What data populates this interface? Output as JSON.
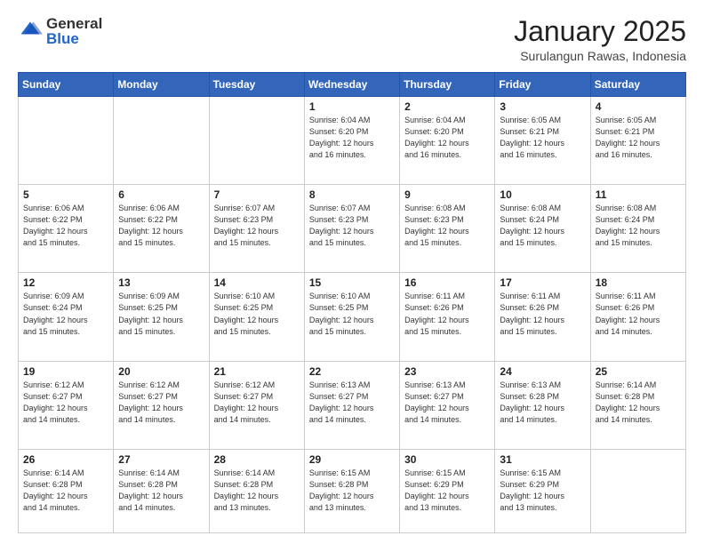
{
  "logo": {
    "general": "General",
    "blue": "Blue"
  },
  "header": {
    "month": "January 2025",
    "location": "Surulangun Rawas, Indonesia"
  },
  "days_of_week": [
    "Sunday",
    "Monday",
    "Tuesday",
    "Wednesday",
    "Thursday",
    "Friday",
    "Saturday"
  ],
  "weeks": [
    [
      {
        "day": "",
        "info": ""
      },
      {
        "day": "",
        "info": ""
      },
      {
        "day": "",
        "info": ""
      },
      {
        "day": "1",
        "info": "Sunrise: 6:04 AM\nSunset: 6:20 PM\nDaylight: 12 hours\nand 16 minutes."
      },
      {
        "day": "2",
        "info": "Sunrise: 6:04 AM\nSunset: 6:20 PM\nDaylight: 12 hours\nand 16 minutes."
      },
      {
        "day": "3",
        "info": "Sunrise: 6:05 AM\nSunset: 6:21 PM\nDaylight: 12 hours\nand 16 minutes."
      },
      {
        "day": "4",
        "info": "Sunrise: 6:05 AM\nSunset: 6:21 PM\nDaylight: 12 hours\nand 16 minutes."
      }
    ],
    [
      {
        "day": "5",
        "info": "Sunrise: 6:06 AM\nSunset: 6:22 PM\nDaylight: 12 hours\nand 15 minutes."
      },
      {
        "day": "6",
        "info": "Sunrise: 6:06 AM\nSunset: 6:22 PM\nDaylight: 12 hours\nand 15 minutes."
      },
      {
        "day": "7",
        "info": "Sunrise: 6:07 AM\nSunset: 6:23 PM\nDaylight: 12 hours\nand 15 minutes."
      },
      {
        "day": "8",
        "info": "Sunrise: 6:07 AM\nSunset: 6:23 PM\nDaylight: 12 hours\nand 15 minutes."
      },
      {
        "day": "9",
        "info": "Sunrise: 6:08 AM\nSunset: 6:23 PM\nDaylight: 12 hours\nand 15 minutes."
      },
      {
        "day": "10",
        "info": "Sunrise: 6:08 AM\nSunset: 6:24 PM\nDaylight: 12 hours\nand 15 minutes."
      },
      {
        "day": "11",
        "info": "Sunrise: 6:08 AM\nSunset: 6:24 PM\nDaylight: 12 hours\nand 15 minutes."
      }
    ],
    [
      {
        "day": "12",
        "info": "Sunrise: 6:09 AM\nSunset: 6:24 PM\nDaylight: 12 hours\nand 15 minutes."
      },
      {
        "day": "13",
        "info": "Sunrise: 6:09 AM\nSunset: 6:25 PM\nDaylight: 12 hours\nand 15 minutes."
      },
      {
        "day": "14",
        "info": "Sunrise: 6:10 AM\nSunset: 6:25 PM\nDaylight: 12 hours\nand 15 minutes."
      },
      {
        "day": "15",
        "info": "Sunrise: 6:10 AM\nSunset: 6:25 PM\nDaylight: 12 hours\nand 15 minutes."
      },
      {
        "day": "16",
        "info": "Sunrise: 6:11 AM\nSunset: 6:26 PM\nDaylight: 12 hours\nand 15 minutes."
      },
      {
        "day": "17",
        "info": "Sunrise: 6:11 AM\nSunset: 6:26 PM\nDaylight: 12 hours\nand 15 minutes."
      },
      {
        "day": "18",
        "info": "Sunrise: 6:11 AM\nSunset: 6:26 PM\nDaylight: 12 hours\nand 14 minutes."
      }
    ],
    [
      {
        "day": "19",
        "info": "Sunrise: 6:12 AM\nSunset: 6:27 PM\nDaylight: 12 hours\nand 14 minutes."
      },
      {
        "day": "20",
        "info": "Sunrise: 6:12 AM\nSunset: 6:27 PM\nDaylight: 12 hours\nand 14 minutes."
      },
      {
        "day": "21",
        "info": "Sunrise: 6:12 AM\nSunset: 6:27 PM\nDaylight: 12 hours\nand 14 minutes."
      },
      {
        "day": "22",
        "info": "Sunrise: 6:13 AM\nSunset: 6:27 PM\nDaylight: 12 hours\nand 14 minutes."
      },
      {
        "day": "23",
        "info": "Sunrise: 6:13 AM\nSunset: 6:27 PM\nDaylight: 12 hours\nand 14 minutes."
      },
      {
        "day": "24",
        "info": "Sunrise: 6:13 AM\nSunset: 6:28 PM\nDaylight: 12 hours\nand 14 minutes."
      },
      {
        "day": "25",
        "info": "Sunrise: 6:14 AM\nSunset: 6:28 PM\nDaylight: 12 hours\nand 14 minutes."
      }
    ],
    [
      {
        "day": "26",
        "info": "Sunrise: 6:14 AM\nSunset: 6:28 PM\nDaylight: 12 hours\nand 14 minutes."
      },
      {
        "day": "27",
        "info": "Sunrise: 6:14 AM\nSunset: 6:28 PM\nDaylight: 12 hours\nand 14 minutes."
      },
      {
        "day": "28",
        "info": "Sunrise: 6:14 AM\nSunset: 6:28 PM\nDaylight: 12 hours\nand 13 minutes."
      },
      {
        "day": "29",
        "info": "Sunrise: 6:15 AM\nSunset: 6:28 PM\nDaylight: 12 hours\nand 13 minutes."
      },
      {
        "day": "30",
        "info": "Sunrise: 6:15 AM\nSunset: 6:29 PM\nDaylight: 12 hours\nand 13 minutes."
      },
      {
        "day": "31",
        "info": "Sunrise: 6:15 AM\nSunset: 6:29 PM\nDaylight: 12 hours\nand 13 minutes."
      },
      {
        "day": "",
        "info": ""
      }
    ]
  ]
}
